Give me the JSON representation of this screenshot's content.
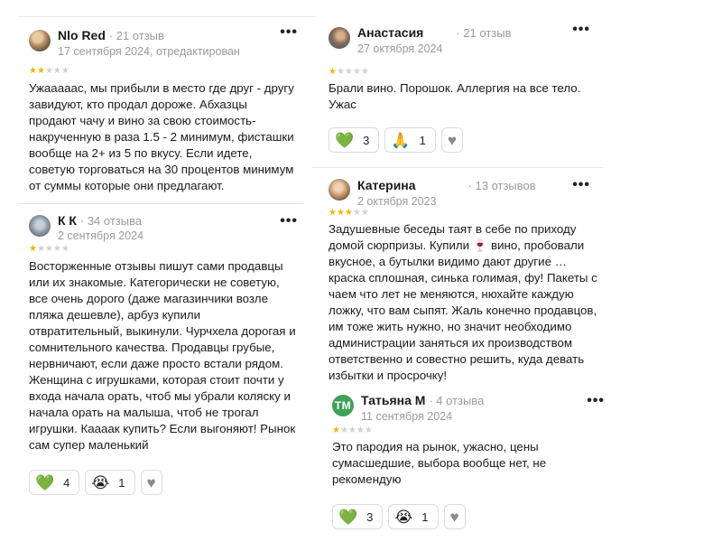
{
  "reviews_left": [
    {
      "author": "Nlo Red",
      "review_count": "21 отзыв",
      "date": "17 сентября 2024, отредактирован",
      "rating": 2,
      "text": "Ужаааааc, мы прибыли в место где друг - другу завидуют, кто продал дороже. Абхазцы продают чачу и вино за свою стоимость- накрученную в раза 1.5 - 2 минимум, фисташки вообще на 2+ из 5 по вкусу. Если идете, советую торговаться на 30 процентов минимум от суммы которые они предлагают."
    },
    {
      "author": "К К",
      "review_count": "34 отзыва",
      "date": "2 сентября 2024",
      "rating": 1,
      "text": "Восторженные отзывы пишут сами продавцы или их знакомые. Категорически не советую, все очень дорого (даже магазинчики возле пляжа дешевле), арбуз купили отвратительный, выкинули. Чурчхела дорогая и сомнительного качества. Продавцы грубые, нервничают, если даже просто встали рядом. Женщина с игрушками, которая стоит почти у входа начала орать, чтоб мы убрали коляску и начала орать на малыша, чтоб не трогал игрушки. Кааaак купить? Если выгоняют! Рынок сам супер маленький",
      "reactions": {
        "like": "4",
        "cry": "1"
      }
    }
  ],
  "reviews_right": [
    {
      "author": "Анастасия",
      "review_count": "21 отзыв",
      "date": "27 октября 2024",
      "rating": 1,
      "text": "Брали вино. Порошок. Аллергия на все тело. Ужас",
      "reactions": {
        "like": "3",
        "pray": "1"
      }
    },
    {
      "author": "Катерина",
      "review_count": "13 отзывов",
      "date": "2 октября 2023",
      "rating": 3,
      "text": "Задушевные беседы таят в себе по приходу домой сюрпризы. Купили 🍷 вино, пробовали вкусное, а бутылки видимо дают другие … краска сплошная, синька голимая, фу! Пакеты с чаем что лет не меняются, нюхайте каждую ложку, что вам сыпят. Жаль конечно продавцов, им тоже жить нужно, но значит необходимо администрации заняться их производством ответственно и совестно решить, куда девать избытки и просрочку!"
    },
    {
      "author": "Татьяна М",
      "initials": "ТМ",
      "review_count": "4 отзыва",
      "date": "11 сентября 2024",
      "rating": 1,
      "text": "Это пародия на рынок, ужасно, цены сумасшедшие, выбора вообще нет, не рекомендую",
      "reactions": {
        "like": "3",
        "cry": "1"
      }
    }
  ],
  "icons": {
    "like": "green-heart-icon",
    "cry": "crying-face-icon",
    "pray": "praying-hands-icon",
    "heart": "grey-heart-icon",
    "more": "more-dots-icon"
  }
}
